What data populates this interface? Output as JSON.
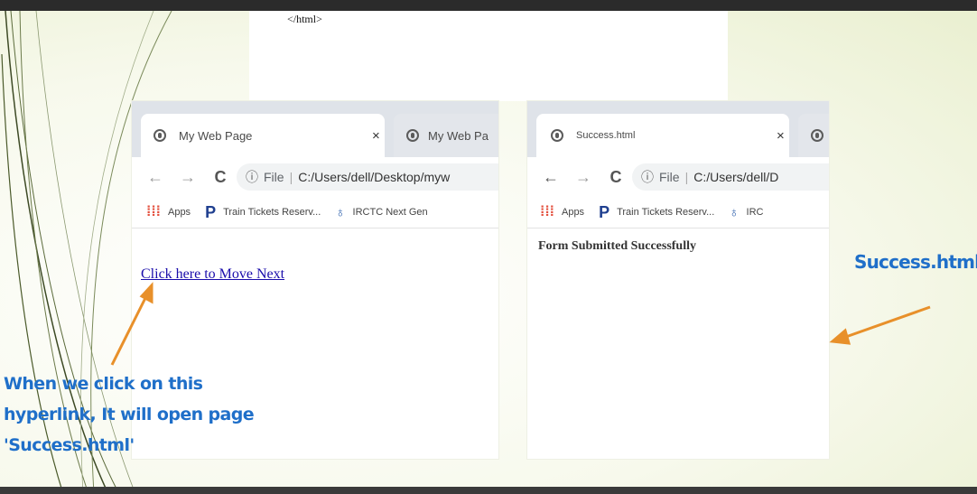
{
  "slide": {
    "code_snippet": "</html>",
    "callout_left": [
      "When we click on this",
      "hyperlink, It will open page",
      "'Success.html'"
    ],
    "callout_right": "Success.html",
    "callout_color": "#1f6fc9",
    "arrow_color": "#e8902a"
  },
  "browser_left": {
    "tabs": [
      {
        "title": "My Web Page",
        "icon": "globe-icon",
        "close": "×"
      },
      {
        "title": "My Web Pa",
        "icon": "globe-icon"
      }
    ],
    "info_icon": "ⓘ",
    "file_label": "File",
    "url": "C:/Users/dell/Desktop/myw",
    "bookmarks": [
      {
        "label": "Apps",
        "icon": "apps-grid-icon"
      },
      {
        "label": "Train Tickets Reserv...",
        "icon": "p-logo-icon"
      },
      {
        "label": "IRCTC Next Gen",
        "icon": "irctc-icon"
      }
    ],
    "link_text": "Click here to Move Next"
  },
  "browser_right": {
    "tabs": [
      {
        "title": "Success.html",
        "icon": "globe-icon",
        "close": "×"
      }
    ],
    "info_icon": "ⓘ",
    "file_label": "File",
    "url": "C:/Users/dell/D",
    "bookmarks": [
      {
        "label": "Apps",
        "icon": "apps-grid-icon"
      },
      {
        "label": "Train Tickets Reserv...",
        "icon": "p-logo-icon"
      },
      {
        "label": "IRC",
        "icon": "irctc-icon"
      }
    ],
    "page_text": "Form Submitted Successfully"
  },
  "nav": {
    "back": "←",
    "forward": "→",
    "reload": "C"
  }
}
